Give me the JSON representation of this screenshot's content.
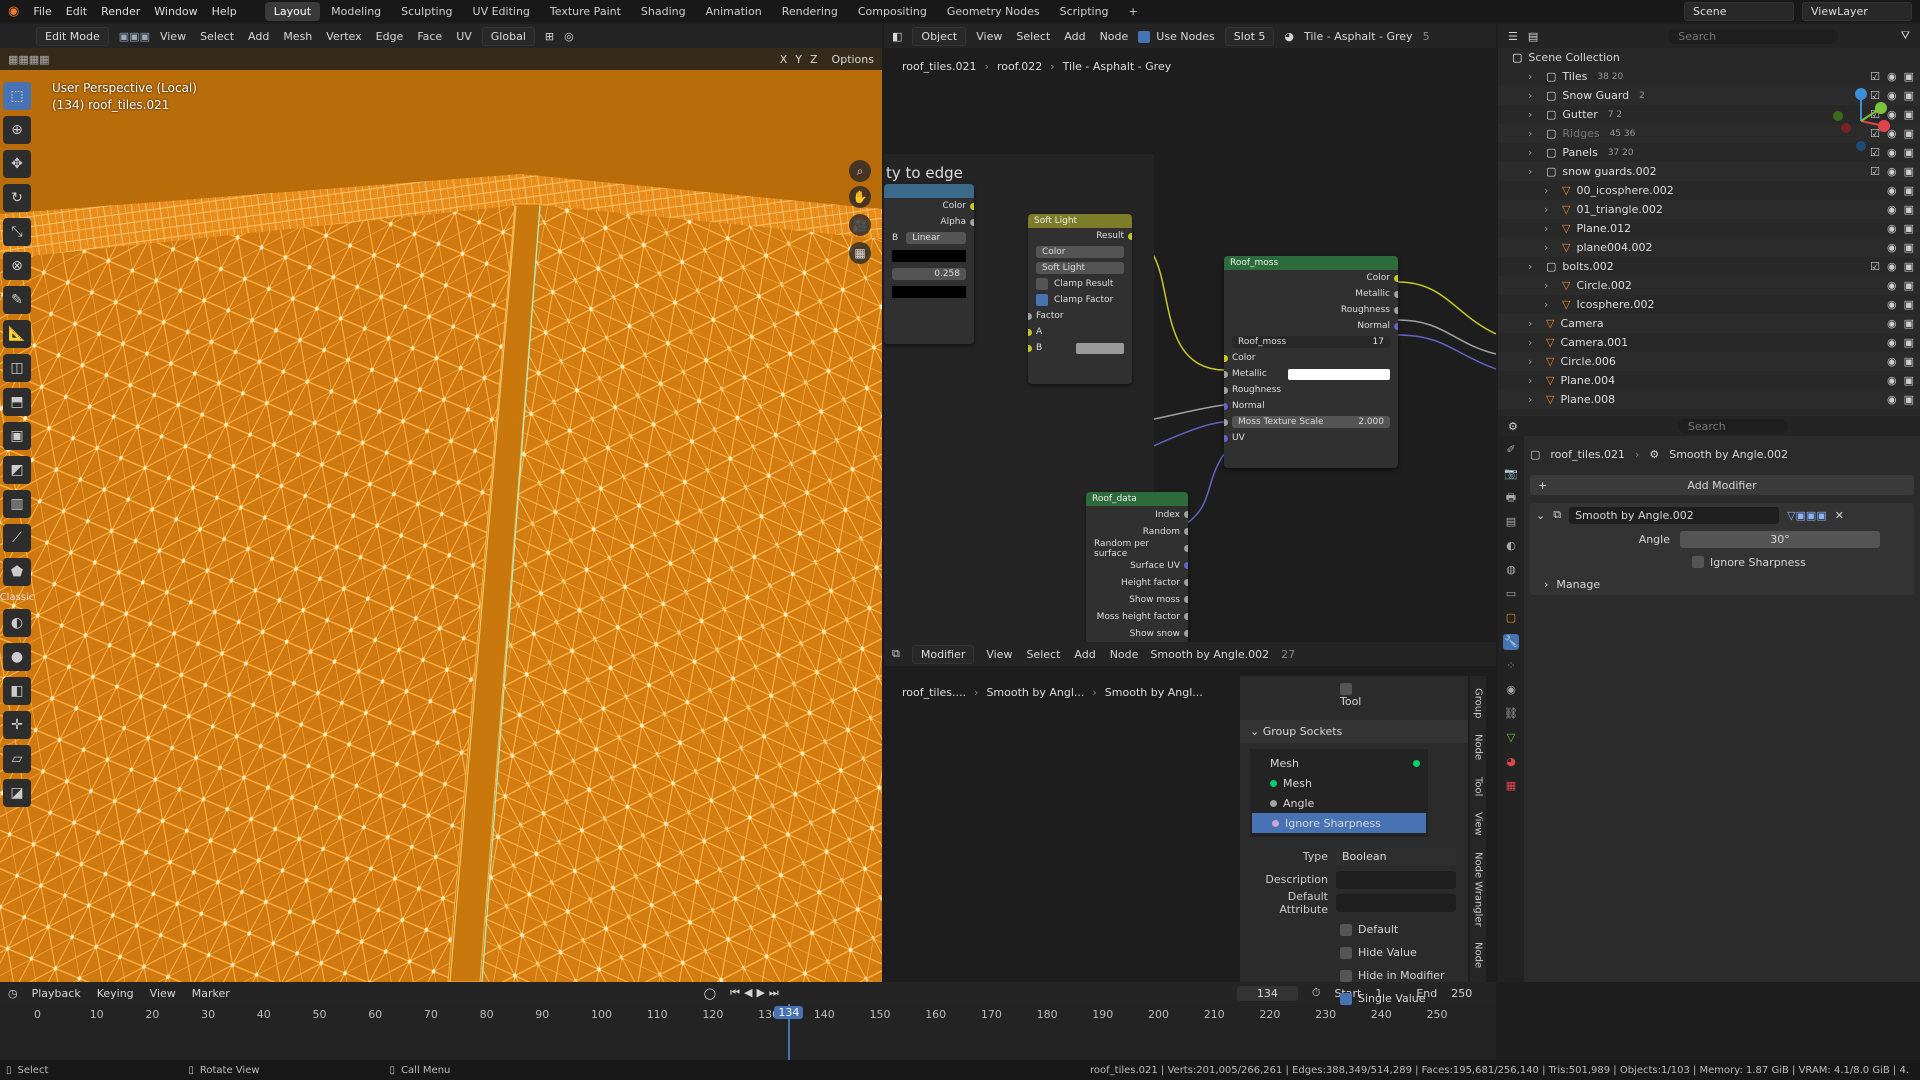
{
  "menu": [
    "File",
    "Edit",
    "Render",
    "Window",
    "Help"
  ],
  "workspaces": [
    "Layout",
    "Modeling",
    "Sculpting",
    "UV Editing",
    "Texture Paint",
    "Shading",
    "Animation",
    "Rendering",
    "Compositing",
    "Geometry Nodes",
    "Scripting",
    "+"
  ],
  "active_workspace": "Layout",
  "scene": {
    "name": "Scene",
    "view_layer": "ViewLayer"
  },
  "viewport": {
    "mode": "Edit Mode",
    "menus": [
      "View",
      "Select",
      "Add",
      "Mesh",
      "Vertex",
      "Edge",
      "Face",
      "UV"
    ],
    "orientation": "Global",
    "options": "Options",
    "axis_labels": [
      "X",
      "Y",
      "Z"
    ],
    "perspective": "User Perspective (Local)",
    "object": "(134) roof_tiles.021",
    "tools_label": "Classic"
  },
  "node_editor": {
    "header": {
      "object": "Object",
      "menus": [
        "View",
        "Select",
        "Add",
        "Node"
      ],
      "use_nodes": "Use Nodes",
      "slot": "Slot 5",
      "material": "Tile - Asphalt - Grey",
      "users": "5"
    },
    "breadcrumb": [
      "roof_tiles.021",
      "roof.022",
      "Tile - Asphalt - Grey"
    ],
    "frame_label": "ty to edge",
    "left_node": {
      "outputs": [
        "Color",
        "Alpha"
      ],
      "dropdown_a": "B",
      "dropdown_b": "Linear",
      "value": "0.258"
    },
    "soft_light": {
      "title": "Soft Light",
      "result": "Result",
      "dd1": "Color",
      "dd2": "Soft Light",
      "clamp_result": "Clamp Result",
      "clamp_factor": "Clamp Factor",
      "inputs": [
        "Factor",
        "A",
        "B"
      ]
    },
    "roof_moss": {
      "title": "Roof_moss",
      "outputs": [
        "Color",
        "Metallic",
        "Roughness",
        "Normal"
      ],
      "group_name": "Roof_moss",
      "group_users": "17",
      "inputs": [
        "Color",
        "Metallic",
        "Roughness",
        "Normal"
      ],
      "moss_texture_scale_label": "Moss Texture Scale",
      "moss_texture_scale": "2.000",
      "uv": "UV"
    },
    "roof_data": {
      "title": "Roof_data",
      "outputs": [
        "Index",
        "Random",
        "Random per surface",
        "Surface UV",
        "Height factor",
        "Show moss",
        "Moss height factor",
        "Show snow"
      ]
    }
  },
  "geo_editor": {
    "header": {
      "editor": "Modifier",
      "menus": [
        "View",
        "Select",
        "Add",
        "Node"
      ],
      "group": "Smooth by Angle.002",
      "users": "27"
    },
    "breadcrumb": [
      "roof_tiles....",
      "Smooth by Angl...",
      "Smooth by Angl..."
    ],
    "tool": "Tool",
    "panel_title": "Group Sockets",
    "sockets": [
      {
        "name": "Mesh",
        "color": "#00d06a",
        "kind": "output"
      },
      {
        "name": "Mesh",
        "color": "#00d06a",
        "kind": "input"
      },
      {
        "name": "Angle",
        "color": "#a1a1a1",
        "kind": "input"
      },
      {
        "name": "Ignore Sharpness",
        "color": "#cca6d6",
        "kind": "input"
      }
    ],
    "selected_socket": "Ignore Sharpness",
    "props": {
      "type_label": "Type",
      "type_value": "Boolean",
      "description_label": "Description",
      "default_attr_label": "Default Attribute"
    },
    "checks": [
      {
        "label": "Default",
        "on": false
      },
      {
        "label": "Hide Value",
        "on": false
      },
      {
        "label": "Hide in Modifier",
        "on": false
      },
      {
        "label": "Single Value",
        "on": true
      }
    ],
    "side_tabs": [
      "Group",
      "Node",
      "Tool",
      "View",
      "Node Wrangler",
      "Node"
    ]
  },
  "outliner": {
    "search_placeholder": "Search",
    "root": "Scene Collection",
    "items": [
      {
        "name": "Tiles",
        "badge": "38 20",
        "indent": 1,
        "checked": true
      },
      {
        "name": "Snow Guard",
        "badge": "2",
        "indent": 1,
        "checked": true
      },
      {
        "name": "Gutter",
        "badge": "7 2",
        "indent": 1,
        "checked": true
      },
      {
        "name": "Ridges",
        "badge": "45 36",
        "indent": 1,
        "checked": true,
        "dim": true
      },
      {
        "name": "Panels",
        "badge": "37 20",
        "indent": 1,
        "checked": true
      },
      {
        "name": "snow guards.002",
        "badge": "",
        "indent": 1,
        "checked": true
      },
      {
        "name": "00_icosphere.002",
        "badge": "",
        "indent": 2
      },
      {
        "name": "01_triangle.002",
        "badge": "",
        "indent": 2
      },
      {
        "name": "Plane.012",
        "badge": "",
        "indent": 2
      },
      {
        "name": "plane004.002",
        "badge": "",
        "indent": 2
      },
      {
        "name": "bolts.002",
        "badge": "",
        "indent": 1,
        "checked": true
      },
      {
        "name": "Circle.002",
        "badge": "",
        "indent": 2
      },
      {
        "name": "Icosphere.002",
        "badge": "",
        "indent": 2
      },
      {
        "name": "Camera",
        "badge": "",
        "indent": 1
      },
      {
        "name": "Camera.001",
        "badge": "",
        "indent": 1
      },
      {
        "name": "Circle.006",
        "badge": "",
        "indent": 1
      },
      {
        "name": "Plane.004",
        "badge": "",
        "indent": 1
      },
      {
        "name": "Plane.008",
        "badge": "",
        "indent": 1
      }
    ]
  },
  "properties": {
    "search_placeholder": "Search",
    "breadcrumb": [
      "roof_tiles.021",
      "Smooth by Angle.002"
    ],
    "add_modifier": "Add Modifier",
    "modifier_name": "Smooth by Angle.002",
    "angle_label": "Angle",
    "angle_value": "30°",
    "ignore_sharpness": "Ignore Sharpness",
    "manage": "Manage"
  },
  "timeline": {
    "menus": [
      "Playback",
      "Keying",
      "View",
      "Marker"
    ],
    "current_frame": "134",
    "start_label": "Start",
    "start": "1",
    "end_label": "End",
    "end": "250",
    "ticks": [
      "0",
      "10",
      "20",
      "30",
      "40",
      "50",
      "60",
      "70",
      "80",
      "90",
      "100",
      "110",
      "120",
      "130",
      "140",
      "150",
      "160",
      "170",
      "180",
      "190",
      "200",
      "210",
      "220",
      "230",
      "240",
      "250"
    ]
  },
  "statusbar": {
    "select": "Select",
    "rotate": "Rotate View",
    "call_menu": "Call Menu",
    "stats": "roof_tiles.021 | Verts:201,005/266,261 | Edges:388,349/514,289 | Faces:195,681/256,140 | Tris:501,989 | Objects:1/103 | Memory: 1.87 GiB | VRAM: 4.1/8.0 GiB | 4.2"
  },
  "colors": {
    "mesh_orange": "#e08a14",
    "accent_blue": "#4772b3",
    "node_purple": "#6363c7"
  }
}
